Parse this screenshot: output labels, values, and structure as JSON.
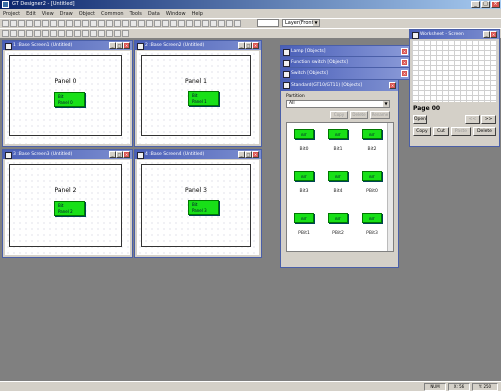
{
  "app": {
    "title": "GT Designer2 - [Untitled]",
    "minimize": "_",
    "maximize": "□",
    "close": "×"
  },
  "menu": [
    "Project",
    "Edit",
    "View",
    "Draw",
    "Object",
    "Common",
    "Tools",
    "Data",
    "Window",
    "Help"
  ],
  "toolbar": {
    "layer_value": "Layer(Front)",
    "dropdown_glyph": "▼"
  },
  "screens": [
    {
      "title": "1 :Base Screen1 (Untitled)",
      "panel": "Panel 0",
      "button": "Bit\nPanel 0"
    },
    {
      "title": "2 :Base Screen2 (Untitled)",
      "panel": "Panel 1",
      "button": "Bit\nPanel 1"
    },
    {
      "title": "3 :Base Screen3 (Untitled)",
      "panel": "Panel 2",
      "button": "Bit\nPanel 2"
    },
    {
      "title": "4 :Base Screen4 (Untitled)",
      "panel": "Panel 3",
      "button": "Bit\nPanel 3"
    }
  ],
  "library": {
    "tabs": [
      "Lamp [Objects]",
      "Function switch [Objects]",
      "Switch [Objects]"
    ],
    "active_title": "Standard(GT10/GT11) [Objects]",
    "partition_label": "Partition",
    "partition_value": "All",
    "buttons": [
      "Copy",
      "Delete",
      "Rename"
    ],
    "items": [
      {
        "text": "BIT",
        "label": "Bit0"
      },
      {
        "text": "BIT",
        "label": "Bit1"
      },
      {
        "text": "BIT",
        "label": "Bit2"
      },
      {
        "text": "BIT",
        "label": "Bit3"
      },
      {
        "text": "BIT",
        "label": "Bit4"
      },
      {
        "text": "BIT",
        "label": "PBit0"
      },
      {
        "text": "BIT",
        "label": "PBit1"
      },
      {
        "text": "BIT",
        "label": "PBit2"
      },
      {
        "text": "BIT",
        "label": "PBit3"
      }
    ]
  },
  "page_panel": {
    "title": "Worksheet - Screen",
    "page_label": "Page 00",
    "open": "Open",
    "prev": "<<",
    "next": ">>",
    "copy": "Copy",
    "cut": "Cut",
    "paste": "Paste",
    "delete": "Delete"
  },
  "status": {
    "mode": "NUM",
    "x": "X: 56",
    "y": "Y: 250"
  },
  "colors": {
    "titlebar": "#4a5fb8",
    "mdi_background": "#808080",
    "object_green": "#18e018",
    "close_red": "#d9534f"
  }
}
